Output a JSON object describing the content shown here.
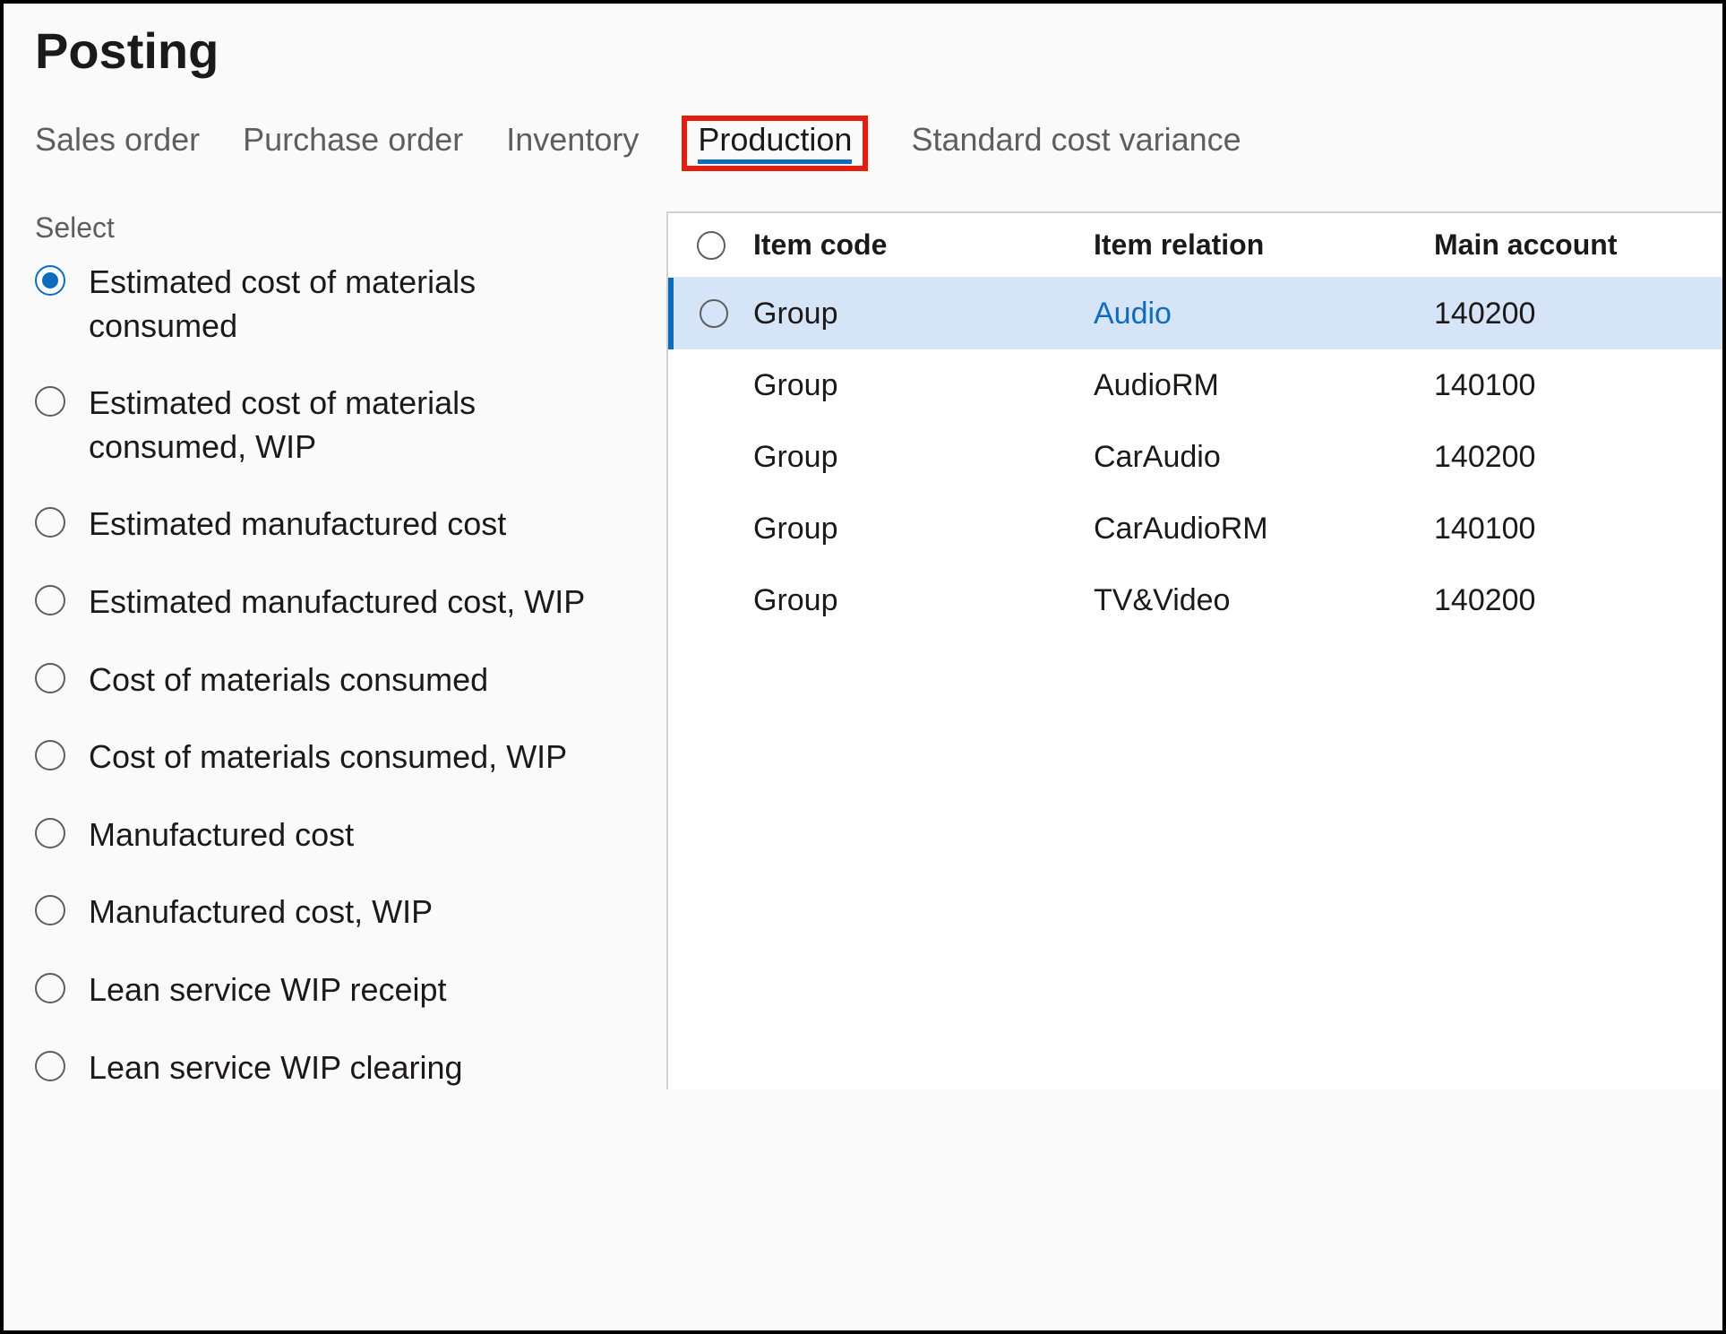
{
  "page_title": "Posting",
  "tabs": [
    {
      "label": "Sales order",
      "active": false
    },
    {
      "label": "Purchase order",
      "active": false
    },
    {
      "label": "Inventory",
      "active": false
    },
    {
      "label": "Production",
      "active": true
    },
    {
      "label": "Standard cost variance",
      "active": false
    }
  ],
  "select_label": "Select",
  "radios": [
    {
      "label": "Estimated cost of materials consumed",
      "selected": true
    },
    {
      "label": "Estimated cost of materials consumed, WIP",
      "selected": false
    },
    {
      "label": "Estimated manufactured cost",
      "selected": false
    },
    {
      "label": "Estimated manufactured cost, WIP",
      "selected": false
    },
    {
      "label": "Cost of materials consumed",
      "selected": false
    },
    {
      "label": "Cost of materials consumed, WIP",
      "selected": false
    },
    {
      "label": "Manufactured cost",
      "selected": false
    },
    {
      "label": "Manufactured cost, WIP",
      "selected": false
    },
    {
      "label": "Lean service WIP receipt",
      "selected": false
    },
    {
      "label": "Lean service WIP clearing",
      "selected": false
    }
  ],
  "grid": {
    "headers": {
      "item_code": "Item code",
      "item_relation": "Item relation",
      "main_account": "Main account"
    },
    "rows": [
      {
        "item_code": "Group",
        "item_relation": "Audio",
        "main_account": "140200",
        "selected": true
      },
      {
        "item_code": "Group",
        "item_relation": "AudioRM",
        "main_account": "140100",
        "selected": false
      },
      {
        "item_code": "Group",
        "item_relation": "CarAudio",
        "main_account": "140200",
        "selected": false
      },
      {
        "item_code": "Group",
        "item_relation": "CarAudioRM",
        "main_account": "140100",
        "selected": false
      },
      {
        "item_code": "Group",
        "item_relation": "TV&Video",
        "main_account": "140200",
        "selected": false
      }
    ]
  }
}
